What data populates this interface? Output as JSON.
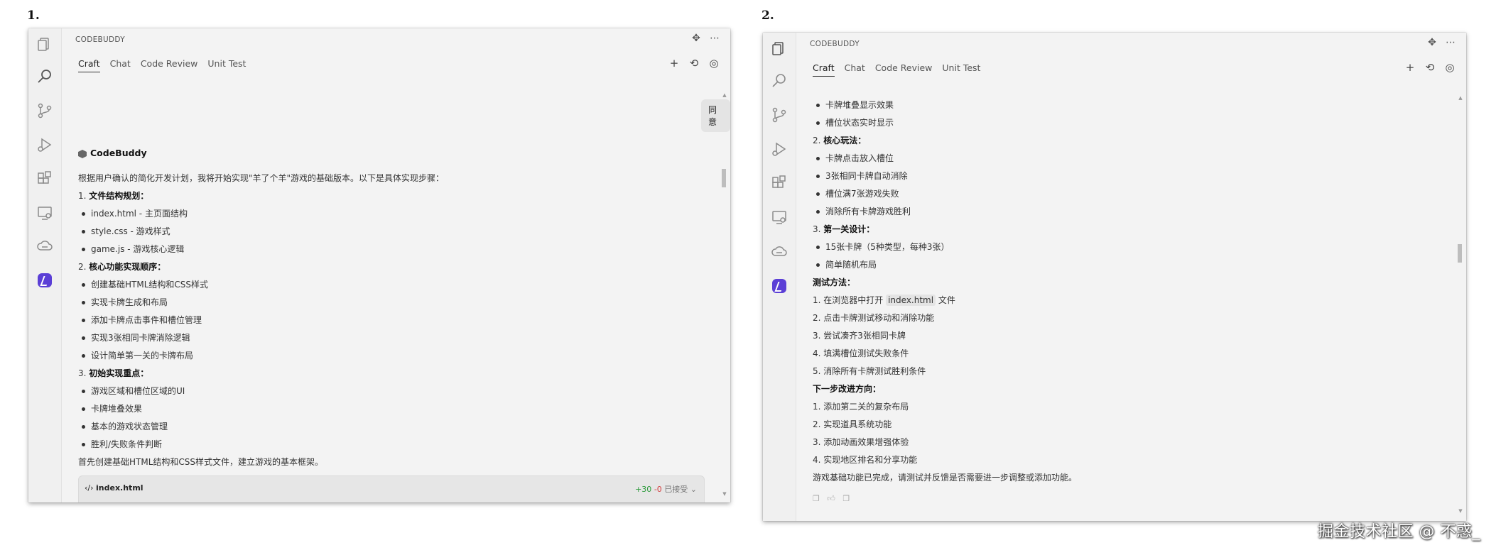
{
  "labels": {
    "panel1": "1.",
    "panel2": "2."
  },
  "app": {
    "title": "CODEBUDDY",
    "tabs": [
      "Craft",
      "Chat",
      "Code Review",
      "Unit Test"
    ],
    "header_icons": [
      "move-icon",
      "more-icon"
    ],
    "tab_actions": [
      "new-chat-icon",
      "history-icon",
      "settings-icon"
    ]
  },
  "activity_bar": [
    "explorer-icon",
    "search-icon",
    "source-control-icon",
    "run-debug-icon",
    "extensions-icon",
    "remote-explorer-icon",
    "cloud-icon",
    "codebuddy-logo"
  ],
  "panel1": {
    "agree_button": "同意",
    "bot_name": "CodeBuddy",
    "intro": "根据用户确认的简化开发计划，我将开始实现\"羊了个羊\"游戏的基础版本。以下是具体实现步骤：",
    "sections": [
      {
        "heading_num": "1.",
        "heading": "文件结构规划",
        "items": [
          "index.html - 主页面结构",
          "style.css - 游戏样式",
          "game.js - 游戏核心逻辑"
        ]
      },
      {
        "heading_num": "2.",
        "heading": "核心功能实现顺序",
        "items": [
          "创建基础HTML结构和CSS样式",
          "实现卡牌生成和布局",
          "添加卡牌点击事件和槽位管理",
          "实现3张相同卡牌消除逻辑",
          "设计简单第一关的卡牌布局"
        ]
      },
      {
        "heading_num": "3.",
        "heading": "初始实现重点",
        "items": [
          "游戏区域和槽位区域的UI",
          "卡牌堆叠效果",
          "基本的游戏状态管理",
          "胜利/失败条件判断"
        ]
      }
    ],
    "closing": "首先创建基础HTML结构和CSS样式文件，建立游戏的基本框架。",
    "code_card": {
      "file": "index.html",
      "added": "+30",
      "removed": "-0",
      "status": "已接受"
    }
  },
  "panel2": {
    "top_items": [
      "卡牌堆叠显示效果",
      "槽位状态实时显示"
    ],
    "sections": [
      {
        "heading_num": "2.",
        "heading": "核心玩法",
        "items": [
          "卡牌点击放入槽位",
          "3张相同卡牌自动消除",
          "槽位满7张游戏失败",
          "消除所有卡牌游戏胜利"
        ]
      },
      {
        "heading_num": "3.",
        "heading": "第一关设计",
        "items": [
          "15张卡牌（5种类型，每种3张）",
          "简单随机布局"
        ]
      }
    ],
    "test_heading": "测试方法",
    "test_steps": [
      {
        "pre": "1. 在浏览器中打开",
        "code": "index.html",
        "post": "文件"
      },
      {
        "pre": "2. 点击卡牌测试移动和消除功能",
        "code": "",
        "post": ""
      },
      {
        "pre": "3. 尝试凑齐3张相同卡牌",
        "code": "",
        "post": ""
      },
      {
        "pre": "4. 填满槽位测试失败条件",
        "code": "",
        "post": ""
      },
      {
        "pre": "5. 消除所有卡牌测试胜利条件",
        "code": "",
        "post": ""
      }
    ],
    "next_heading": "下一步改进方向",
    "next_steps": [
      "1. 添加第二关的复杂布局",
      "2. 实现道具系统功能",
      "3. 添加动画效果增强体验",
      "4. 实现地区排名和分享功能"
    ],
    "closing": "游戏基础功能已完成，请测试并反馈是否需要进一步调整或添加功能。"
  },
  "watermark": "掘金技术社区 @ 不惑_"
}
